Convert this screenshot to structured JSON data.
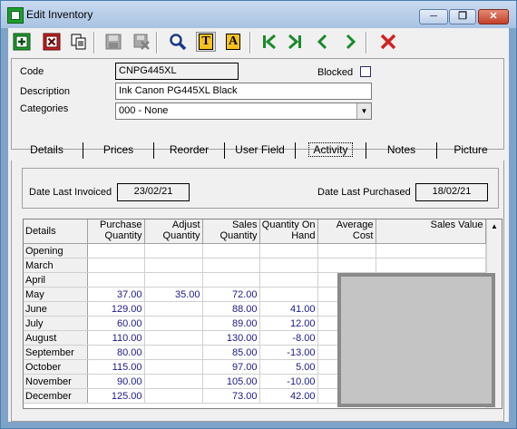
{
  "window": {
    "title": "Edit Inventory",
    "minimize_glyph": "─",
    "restore_glyph": "❐",
    "close_glyph": "✕"
  },
  "toolbar": {
    "icons": [
      "add-icon",
      "delete-icon",
      "copy-icon",
      "save-icon",
      "cancel-save-icon",
      "find-icon",
      "text-t-icon",
      "text-a-icon",
      "first-record-icon",
      "last-record-icon",
      "previous-record-icon",
      "next-record-icon",
      "close-x-icon"
    ],
    "text_t": "T",
    "text_a": "A"
  },
  "form": {
    "code_label": "Code",
    "code_value": "CNPG445XL",
    "blocked_label": "Blocked",
    "description_label": "Description",
    "description_value": "Ink Canon PG445XL Black",
    "categories_label": "Categories",
    "categories_value": "000 - None"
  },
  "tabs": [
    "Details",
    "Prices",
    "Reorder",
    "User Field",
    "Activity",
    "Notes",
    "Picture"
  ],
  "active_tab": "Activity",
  "activity": {
    "last_invoiced_label": "Date Last Invoiced",
    "last_invoiced_value": "23/02/21",
    "last_purchased_label": "Date Last Purchased",
    "last_purchased_value": "18/02/21"
  },
  "grid": {
    "columns": [
      "Details",
      "Purchase Quantity",
      "Adjust Quantity",
      "Sales Quantity",
      "Quantity On Hand",
      "Average Cost",
      "Sales Value"
    ],
    "rows": [
      [
        "Opening",
        "",
        "",
        "",
        "",
        "",
        ""
      ],
      [
        "March",
        "",
        "",
        "",
        "",
        "",
        ""
      ],
      [
        "April",
        "",
        "",
        "",
        "",
        "",
        ""
      ],
      [
        "May",
        "37.00",
        "35.00",
        "72.00",
        "",
        "",
        ""
      ],
      [
        "June",
        "129.00",
        "",
        "88.00",
        "41.00",
        "",
        ""
      ],
      [
        "July",
        "60.00",
        "",
        "89.00",
        "12.00",
        "",
        ""
      ],
      [
        "August",
        "110.00",
        "",
        "130.00",
        "-8.00",
        "",
        ""
      ],
      [
        "September",
        "80.00",
        "",
        "85.00",
        "-13.00",
        "",
        ""
      ],
      [
        "October",
        "115.00",
        "",
        "97.00",
        "5.00",
        "",
        ""
      ],
      [
        "November",
        "90.00",
        "",
        "105.00",
        "-10.00",
        "",
        ""
      ],
      [
        "December",
        "125.00",
        "",
        "73.00",
        "42.00",
        "",
        ""
      ]
    ]
  },
  "colors": {
    "titlebar": "#b7cde8",
    "value_text": "#1a1a8a",
    "close_red": "#d42020",
    "nav_green": "#1a8a2a"
  }
}
